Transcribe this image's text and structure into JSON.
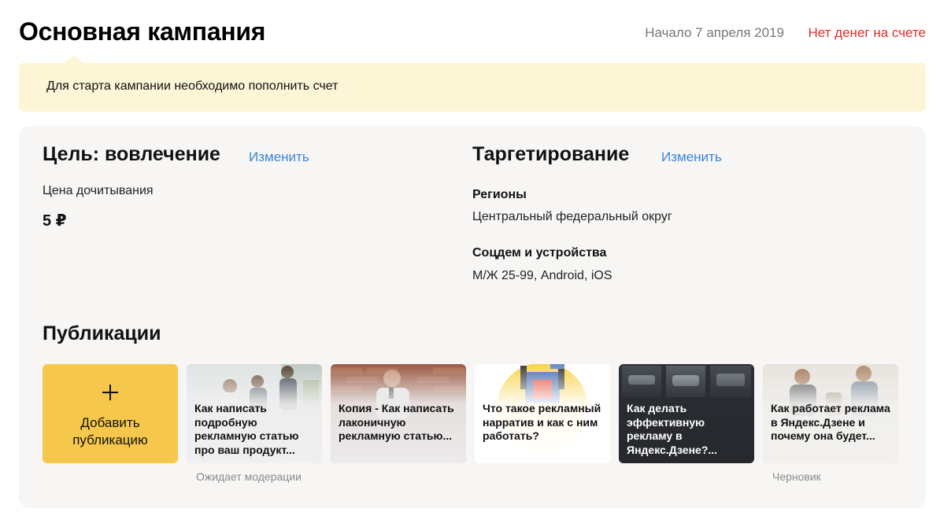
{
  "header": {
    "title": "Основная кампания",
    "start_date": "Начало 7 апреля 2019",
    "money_status": "Нет денег на счете"
  },
  "notice": {
    "text": "Для старта кампании необходимо пополнить счет"
  },
  "goal": {
    "title": "Цель: вовлечение",
    "edit_label": "Изменить",
    "price_label": "Цена дочитывания",
    "price_value": "5 ₽"
  },
  "targeting": {
    "title": "Таргетирование",
    "edit_label": "Изменить",
    "regions_label": "Регионы",
    "regions_value": "Центральный федеральный округ",
    "socdem_label": "Соцдем и устройства",
    "socdem_value": "М/Ж 25-99, Android, iOS"
  },
  "publications": {
    "title": "Публикации",
    "add_label": "Добавить публикацию",
    "items": [
      {
        "title": "Как написать подробную рекламную статью про ваш продукт...",
        "status": "Ожидает модерации"
      },
      {
        "title": "Копия - Как написать лаконичную рекламную статью...",
        "status": ""
      },
      {
        "title": "Что такое рекламный нарратив и как с ним работать?",
        "status": ""
      },
      {
        "title": "Как делать эффективную рекламу в Яндекс.Дзене?...",
        "status": ""
      },
      {
        "title": "Как работает реклама в Яндекс.Дзене и почему она будет...",
        "status": "Черновик"
      }
    ]
  },
  "colors": {
    "accent_link": "#3b85d8",
    "alert_red": "#e02d2d",
    "notice_bg": "#fcf5d6",
    "add_card_bg": "#f5c84c"
  }
}
